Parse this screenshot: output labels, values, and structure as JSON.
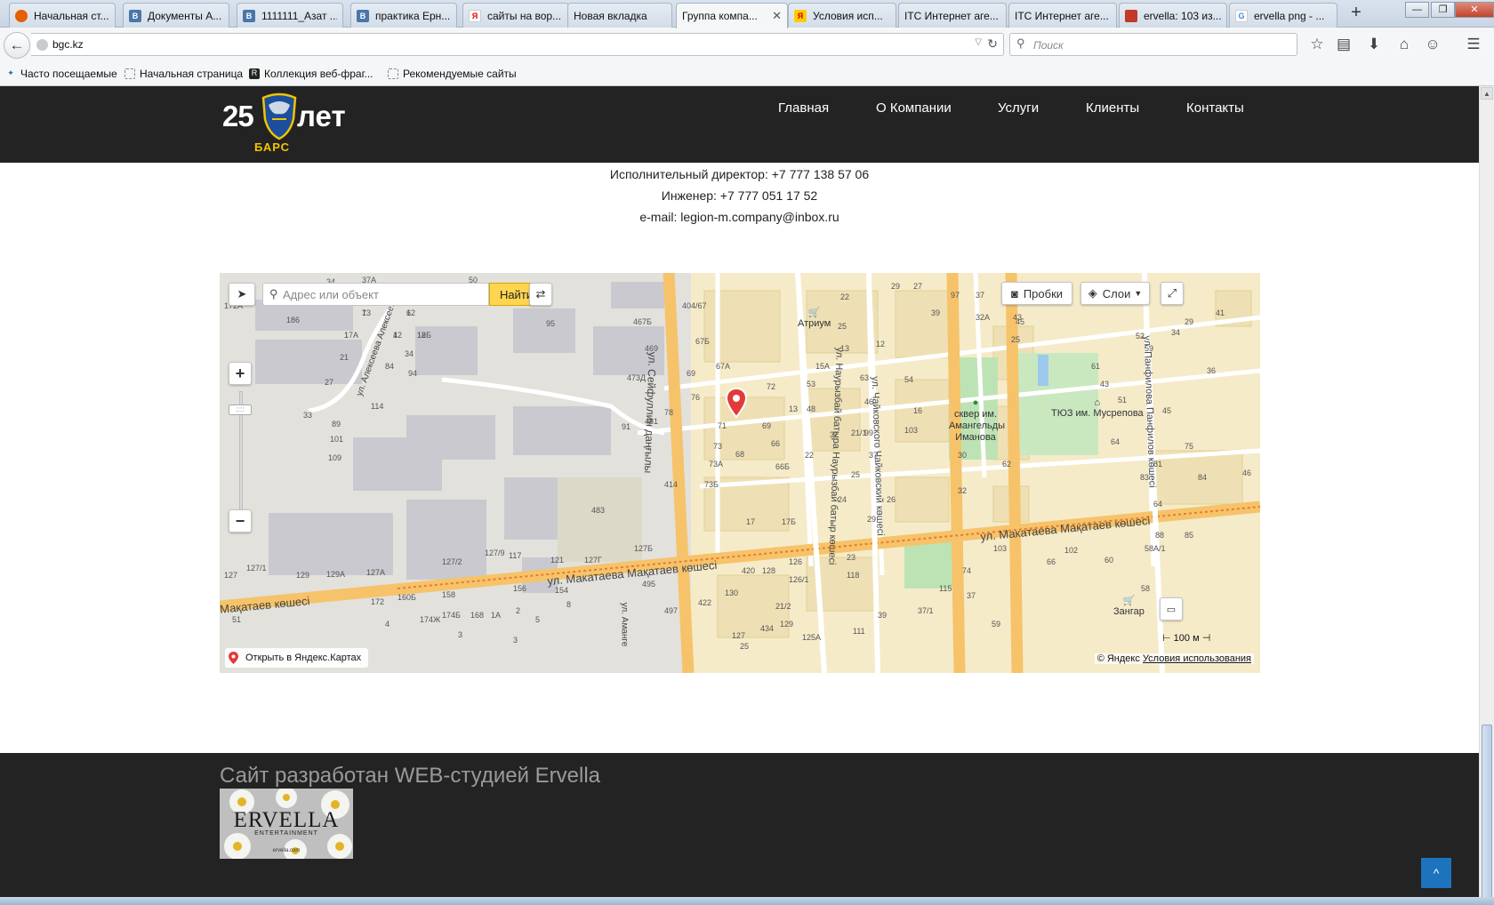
{
  "browser": {
    "tabs": [
      {
        "title": "Начальная ст...",
        "icon": "firefox-icon",
        "color": "#e66000"
      },
      {
        "title": "Документы А...",
        "icon": "vk-icon",
        "color": "#4a76a8"
      },
      {
        "title": "1111111_Азат ...",
        "icon": "vk-icon",
        "color": "#4a76a8"
      },
      {
        "title": "практика Ерн...",
        "icon": "vk-icon",
        "color": "#4a76a8"
      },
      {
        "title": "сайты на вор...",
        "icon": "yandex-icon",
        "color": "#ffffff"
      },
      {
        "title": "Новая вкладка",
        "icon": "",
        "color": ""
      },
      {
        "title": "Группа компа...",
        "icon": "",
        "color": "",
        "active": true
      },
      {
        "title": "Условия исп...",
        "icon": "yandex-icon",
        "color": "#ffcc00"
      },
      {
        "title": "ITC Интернет аге...",
        "icon": "",
        "color": ""
      },
      {
        "title": "ITC Интернет аге...",
        "icon": "",
        "color": ""
      },
      {
        "title": "ervella: 103 из...",
        "icon": "image-icon",
        "color": "#c0392b"
      },
      {
        "title": "ervella png - ...",
        "icon": "google-icon",
        "color": "#4285f4"
      }
    ],
    "url": "bgc.kz",
    "search_placeholder": "Поиск",
    "bookmarks": [
      "Часто посещаемые",
      "Начальная страница",
      "Коллекция веб-фраг...",
      "Рекомендуемые сайты"
    ]
  },
  "site": {
    "logo": {
      "number": "25",
      "word": "лет",
      "brand": "БАРС"
    },
    "nav": [
      "Главная",
      "О Компании",
      "Услуги",
      "Клиенты",
      "Контакты"
    ],
    "contacts": [
      "Исполнительный директор: +7 777 138 57 06",
      "Инженер: +7 777 051 17 52",
      "e-mail: legion-m.company@inbox.ru"
    ],
    "map": {
      "search_placeholder": "Адрес или объект",
      "find_label": "Найти",
      "traffic_label": "Пробки",
      "layers_label": "Слои",
      "open_label": "Открыть в Яндекс.Картах",
      "copyright": "© Яндекс",
      "terms": "Условия использования",
      "scale": "100 м",
      "streets": [
        "ул. Макатаева Мақатаев көшесі",
        "ул. Макатаева Мақатаев көшесі",
        "Мақатаев көшесі",
        "ул. Сейфуллин даңғылы",
        "ул. Наурызбай батыра Наурызбай батыр көшесі",
        "ул. Чайковского Чайковский көшесі",
        "ул. Панфилова Панфилов көшесі",
        "ул. Алексеева Алексеев",
        "ул. Аманге"
      ],
      "pois": [
        "Атриум",
        "сквер им. Амангельды Иманова",
        "ТЮЗ им. Мусрепова",
        "Зангар"
      ],
      "house_numbers": [
        "13",
        "12",
        "17А",
        "42",
        "18",
        "21",
        "84",
        "34",
        "94",
        "27",
        "114",
        "33",
        "89",
        "101",
        "109",
        "95",
        "467Б",
        "469",
        "473Д",
        "91",
        "481",
        "404/67",
        "67Б",
        "69",
        "67А",
        "76",
        "78",
        "72",
        "13",
        "71",
        "69",
        "73",
        "68",
        "66",
        "73А",
        "66Б",
        "73Б",
        "414",
        "483",
        "17",
        "17Б",
        "127Б",
        "117",
        "127/9",
        "121",
        "127Г",
        "127/2",
        "127А",
        "129А",
        "129",
        "127/1",
        "127",
        "156",
        "158",
        "154",
        "495",
        "420",
        "128",
        "126",
        "126/1",
        "130",
        "21/2",
        "422",
        "497",
        "434",
        "127",
        "125А",
        "25",
        "129",
        "23",
        "118",
        "37/1",
        "111",
        "39",
        "115",
        "37",
        "59",
        "74",
        "103",
        "66",
        "102",
        "60",
        "58А/1",
        "58",
        "88",
        "85",
        "83",
        "84",
        "64",
        "46",
        "81",
        "75",
        "30",
        "32",
        "62",
        "64",
        "51",
        "43",
        "45",
        "61",
        "59",
        "36",
        "34",
        "52",
        "29",
        "41",
        "43",
        "25",
        "45",
        "32А",
        "37",
        "39",
        "29",
        "27",
        "22",
        "25",
        "13",
        "12",
        "15А",
        "53",
        "63",
        "54",
        "48",
        "46",
        "16",
        "21/1",
        "32",
        "37",
        "22",
        "25",
        "24",
        "26",
        "29",
        "99",
        "103",
        "97",
        "51",
        "34",
        "37А",
        "50",
        "186",
        "172А",
        "172",
        "160Б",
        "174Ж",
        "174Б",
        "168",
        "1А",
        "2",
        "5",
        "3",
        "8",
        "4",
        "3",
        "7",
        "6",
        "1",
        "1",
        "12Б"
      ]
    },
    "footer": {
      "credit": "Сайт разработан WEB-студией Ervella",
      "logo_brand": "ERVELLA",
      "logo_sub": "ENTERTAINMENT",
      "logo_url": "ervella.com"
    }
  },
  "colors": {
    "header_bg": "#232323",
    "footer_bg": "#232323",
    "map_find": "#ffd54f",
    "scroll_to_top": "#1e73be",
    "logo_accent": "#f3c300"
  }
}
